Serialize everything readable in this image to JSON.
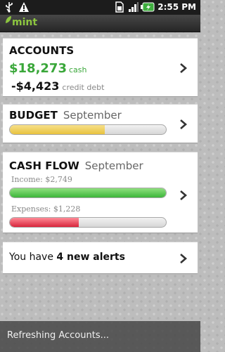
{
  "status_bar": {
    "time": "2:55 PM",
    "icons": [
      "usb-icon",
      "warning-icon",
      "sim-icon",
      "signal-icon",
      "battery-icon"
    ]
  },
  "header": {
    "logo_text": "mint"
  },
  "accounts": {
    "title": "ACCOUNTS",
    "cash_value": "$18,273",
    "cash_label": "cash",
    "debt_value": "-$4,423",
    "debt_label": "credit debt"
  },
  "budget": {
    "title": "BUDGET",
    "month": "September",
    "progress": 0.61
  },
  "cash_flow": {
    "title": "CASH FLOW",
    "month": "September",
    "income_label": "Income: $2,749",
    "income_progress": 1.0,
    "expenses_label": "Expenses: $1,228",
    "expenses_progress": 0.44
  },
  "alerts": {
    "prefix": "You have ",
    "emphasis": "4 new alerts"
  },
  "toast": {
    "text": "Refreshing Accounts..."
  },
  "colors": {
    "cash_green": "#3aa73a",
    "budget_yellow": "#e8c23e",
    "income_green": "#3cb53a",
    "expense_red": "#d7263c"
  }
}
